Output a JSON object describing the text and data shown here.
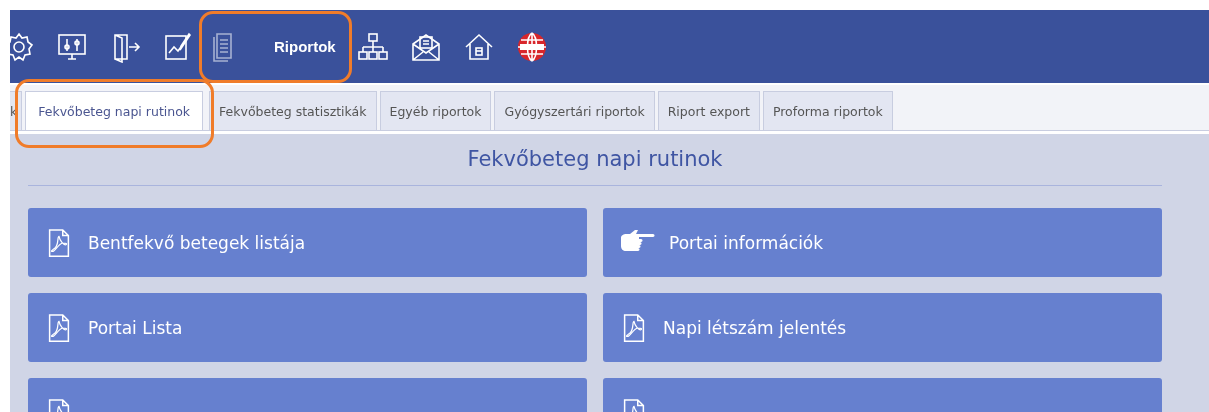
{
  "nav": [
    {
      "kind": "gear",
      "selected": false,
      "highlighted": false
    },
    {
      "kind": "monitor",
      "selected": false,
      "highlighted": false
    },
    {
      "kind": "exit",
      "selected": false,
      "highlighted": false
    },
    {
      "kind": "chart",
      "selected": false,
      "highlighted": false
    },
    {
      "kind": "documents",
      "label": "Riportok",
      "selected": true,
      "highlighted": true
    },
    {
      "kind": "sitemap",
      "selected": false,
      "highlighted": false
    },
    {
      "kind": "envelope",
      "selected": false,
      "highlighted": false
    },
    {
      "kind": "home",
      "selected": false,
      "highlighted": false
    },
    {
      "kind": "globe",
      "selected": false,
      "highlighted": false
    }
  ],
  "tabs": [
    {
      "label": "k",
      "selected": false,
      "highlighted": false
    },
    {
      "label": "Fekvőbeteg napi rutinok",
      "selected": true,
      "highlighted": true
    },
    {
      "label": "Fekvőbeteg statisztikák",
      "selected": false,
      "highlighted": false
    },
    {
      "label": "Egyéb riportok",
      "selected": false,
      "highlighted": false
    },
    {
      "label": "Gyógyszertári riportok",
      "selected": false,
      "highlighted": false
    },
    {
      "label": "Riport export",
      "selected": false,
      "highlighted": false
    },
    {
      "label": "Proforma riportok",
      "selected": false,
      "highlighted": false
    }
  ],
  "panel": {
    "title": "Fekvőbeteg napi rutinok",
    "buttons": [
      {
        "kind": "pdf",
        "label": "Bentfekvő betegek listája"
      },
      {
        "kind": "hand",
        "label": "Portai információk"
      },
      {
        "kind": "pdf",
        "label": "Portai Lista"
      },
      {
        "kind": "pdf",
        "label": "Napi létszám jelentés"
      },
      {
        "kind": "pdf"
      },
      {
        "kind": "pdf"
      }
    ]
  }
}
